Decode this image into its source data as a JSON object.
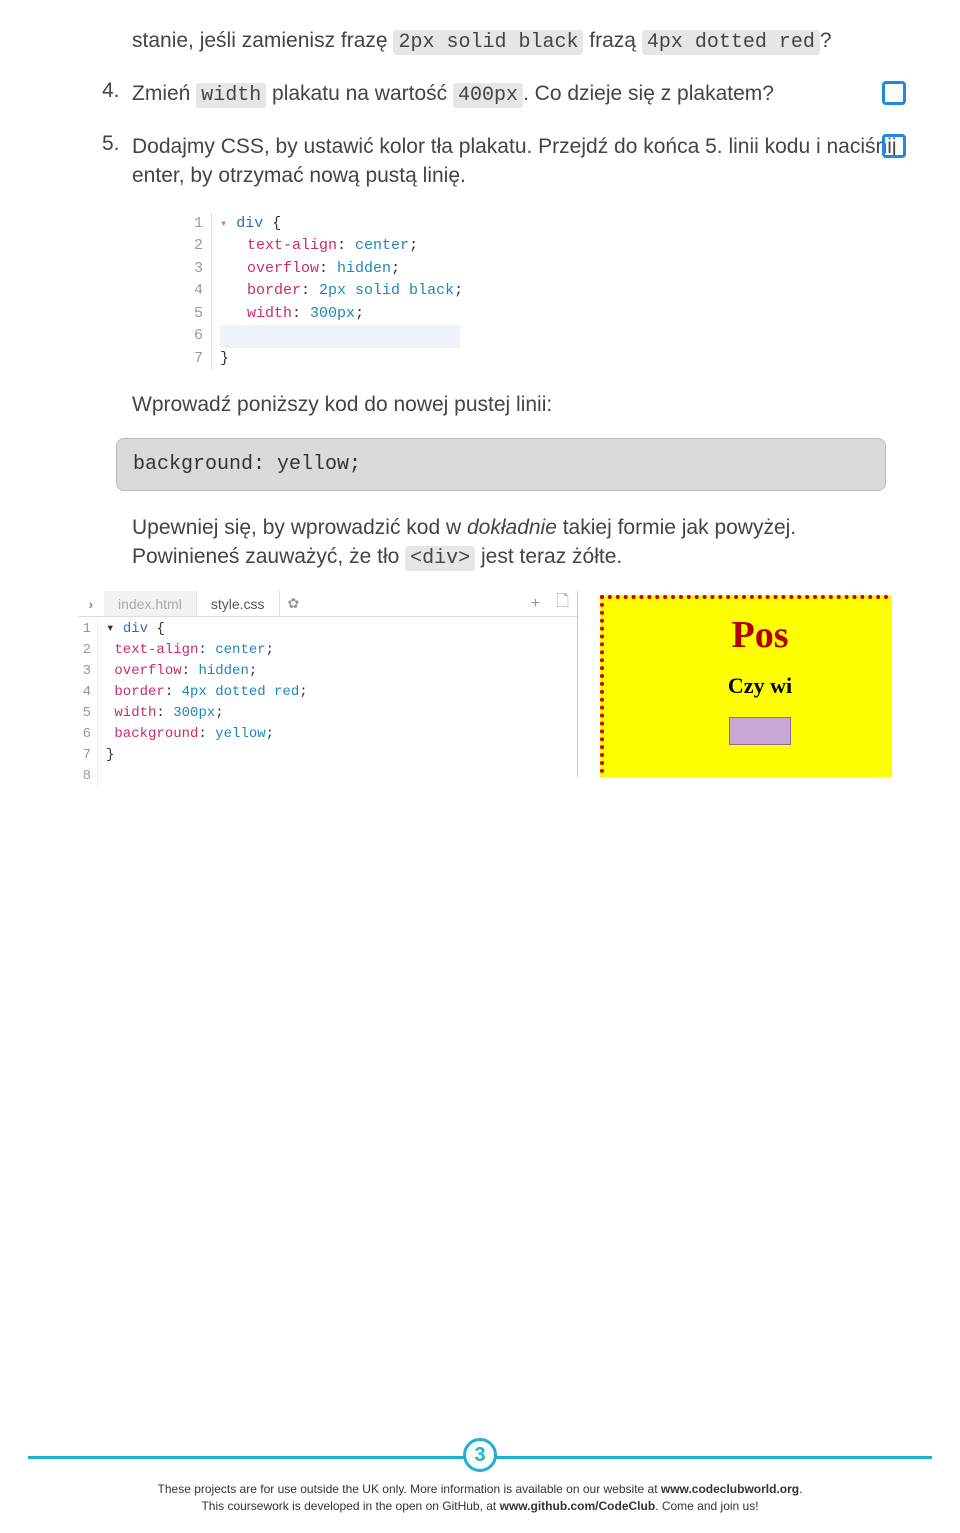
{
  "step3": {
    "text_a": "stanie, jeśli zamienisz frazę ",
    "code_a": "2px solid black",
    "text_b": " frazą ",
    "code_b": "4px dotted red",
    "text_c": "?"
  },
  "step4": {
    "num": "4.",
    "text_a": "Zmień ",
    "code_a": "width",
    "text_b": " plakatu na wartość ",
    "code_b": "400px",
    "text_c": ". Co dzieje się z plakatem?"
  },
  "step5": {
    "num": "5.",
    "text": "Dodajmy CSS, by ustawić kolor tła plakatu. Przejdź do końca 5. linii kodu i naciśnij enter, by otrzymać nową pustą linię."
  },
  "editor1": {
    "lines": [
      {
        "n": "1",
        "arrow": true,
        "kw": "div",
        "rest": " {"
      },
      {
        "n": "2",
        "prop": "text-align",
        "val": "center"
      },
      {
        "n": "3",
        "prop": "overflow",
        "val": "hidden"
      },
      {
        "n": "4",
        "prop": "border",
        "val": "2px solid black"
      },
      {
        "n": "5",
        "prop": "width",
        "val": "300px"
      },
      {
        "n": "6",
        "blank": true
      },
      {
        "n": "7",
        "close": "}"
      }
    ]
  },
  "intro_line": "Wprowadź poniższy kod do nowej pustej linii:",
  "code_box": "background: yellow;",
  "confirm": {
    "text_a": "Upewniej się, by wprowadzić kod w ",
    "em": "dokładnie",
    "text_b": " takiej formie jak powyżej. Powinieneś zauważyć, że tło ",
    "code": "<div>",
    "text_c": " jest teraz żółte."
  },
  "shot": {
    "tab1": "index.html",
    "tab2": "style.css",
    "gear": "✿",
    "plus": "+",
    "file": "🗋"
  },
  "editor2": {
    "lines": [
      {
        "n": "1",
        "arrow": true,
        "kw": "div",
        "rest": " {"
      },
      {
        "n": "2",
        "prop": "text-align",
        "val": "center"
      },
      {
        "n": "3",
        "prop": "overflow",
        "val": "hidden"
      },
      {
        "n": "4",
        "prop": "border",
        "val": "4px dotted red"
      },
      {
        "n": "5",
        "prop": "width",
        "val": "300px"
      },
      {
        "n": "6",
        "prop": "background",
        "val": "yellow"
      },
      {
        "n": "7",
        "close": "}"
      },
      {
        "n": "8",
        "empty": true
      }
    ]
  },
  "poster": {
    "title": "Pos",
    "sub": "Czy wi"
  },
  "footer": {
    "page": "3",
    "line1_a": "These projects are for use outside the UK only. More information is available on our website at ",
    "line1_b": "www.codeclubworld.org",
    "line1_c": ".",
    "line2_a": "This coursework is developed in the open on GitHub, at ",
    "line2_b": "www.github.com/CodeClub",
    "line2_c": ". Come and join us!"
  }
}
